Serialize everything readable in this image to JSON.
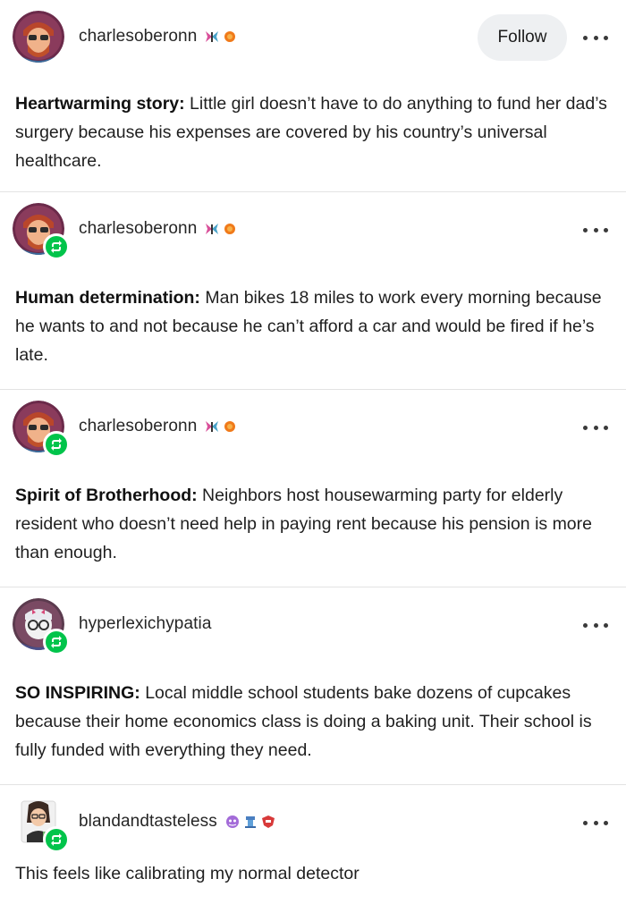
{
  "posts": [
    {
      "username": "charlesoberonn",
      "show_follow": true,
      "follow_label": "Follow",
      "is_reblog": false,
      "headline": "Heartwarming story:",
      "text": " Little girl doesn’t have to do anything to fund her dad’s surgery because his expenses are covered by his country’s universal healthcare."
    },
    {
      "username": "charlesoberonn",
      "show_follow": false,
      "is_reblog": true,
      "headline": "Human determination:",
      "text": " Man bikes 18 miles to work every morning because he wants to and not because he can’t afford a car and would be fired if he’s late."
    },
    {
      "username": "charlesoberonn",
      "show_follow": false,
      "is_reblog": true,
      "headline": "Spirit of Brotherhood:",
      "text": " Neighbors host housewarming party for elderly resident who doesn’t need help in paying rent because his pension is more than enough."
    },
    {
      "username": "hyperlexichypatia",
      "show_follow": false,
      "is_reblog": true,
      "headline": "SO INSPIRING:",
      "text": " Local middle school students bake dozens of cupcakes because their home economics class is doing a baking unit. Their school is fully funded with everything they need."
    },
    {
      "username": "blandandtasteless",
      "show_follow": false,
      "is_reblog": true,
      "headline": "",
      "text": "This feels like calibrating my normal detector"
    }
  ],
  "colors": {
    "reblog_badge": "#01c44b",
    "follow_bg": "#eef0f2",
    "divider": "#e3e3e3"
  },
  "icons": {
    "more": "more-options-icon",
    "reblog": "reblog-icon",
    "badges": "user-badge-icon"
  }
}
